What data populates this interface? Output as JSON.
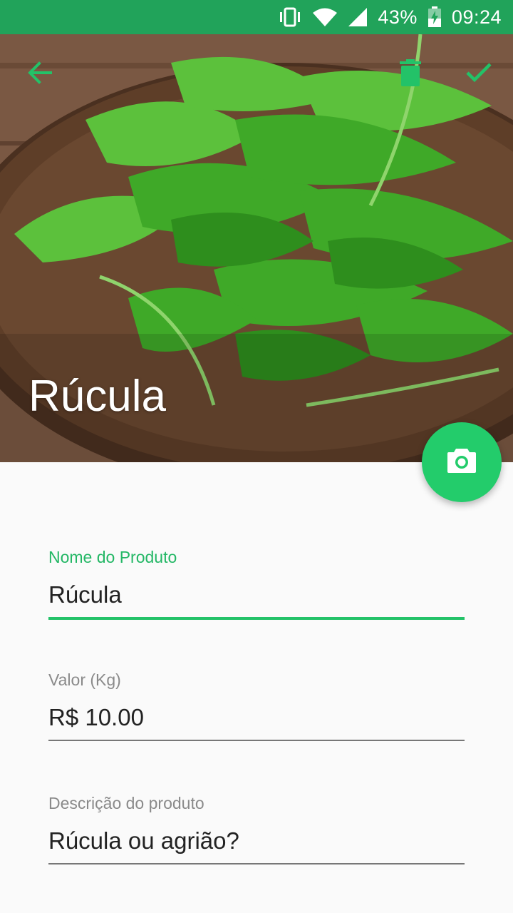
{
  "status_bar": {
    "battery": "43%",
    "time": "09:24",
    "icons": [
      "vibrate-icon",
      "wifi-icon",
      "signal-icon",
      "battery-charging-icon"
    ]
  },
  "toolbar": {
    "back_icon": "arrow-back-icon",
    "delete_icon": "trash-icon",
    "confirm_icon": "check-icon",
    "accent_color": "#23c268"
  },
  "header": {
    "title": "Rúcula"
  },
  "fab": {
    "icon": "camera-icon",
    "color": "#23cc6b"
  },
  "form": {
    "name": {
      "label": "Nome do Produto",
      "value": "Rúcula"
    },
    "price": {
      "label": "Valor (Kg)",
      "value": "R$ 10.00"
    },
    "description": {
      "label": "Descrição do produto",
      "value": "Rúcula ou agrião?"
    }
  }
}
